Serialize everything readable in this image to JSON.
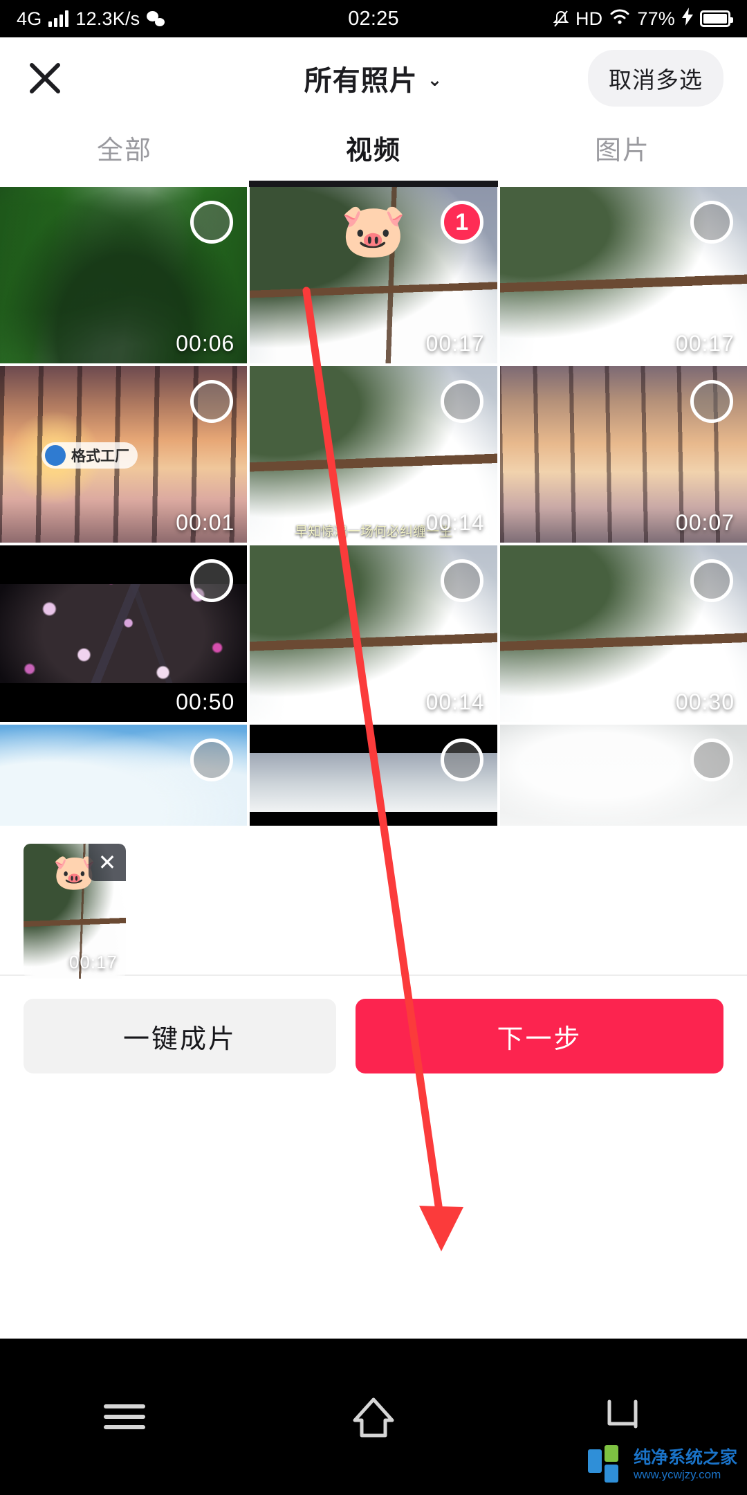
{
  "status_bar": {
    "network_type": "4G",
    "data_rate": "12.3K/s",
    "time": "02:25",
    "hd_label": "HD",
    "battery_percent": "77%",
    "icons": [
      "signal-bars-icon",
      "wechat-icon",
      "mute-icon",
      "wifi-icon",
      "charging-bolt-icon",
      "battery-icon"
    ]
  },
  "header": {
    "close_label": "✕",
    "title": "所有照片",
    "caret": "⌄",
    "multi_select_button": "取消多选"
  },
  "tabs": [
    {
      "label": "全部",
      "active": false
    },
    {
      "label": "视频",
      "active": true
    },
    {
      "label": "图片",
      "active": false
    }
  ],
  "grid": {
    "items": [
      {
        "duration": "00:06",
        "selected": false,
        "badge": "",
        "scene": "scene-waterfall",
        "overlay": ""
      },
      {
        "duration": "00:17",
        "selected": true,
        "badge": "1",
        "scene": "scene-snowbridge",
        "overlay": "pig"
      },
      {
        "duration": "00:17",
        "selected": false,
        "badge": "",
        "scene": "scene-snowbridge2",
        "overlay": ""
      },
      {
        "duration": "00:01",
        "selected": false,
        "badge": "",
        "scene": "scene-sunset",
        "overlay": "watermark",
        "watermark_text": "格式工厂"
      },
      {
        "duration": "00:14",
        "selected": false,
        "badge": "",
        "scene": "scene-snowbridge2",
        "overlay": "caption",
        "caption": "早知惊鸿一场何必纠缠一生"
      },
      {
        "duration": "00:07",
        "selected": false,
        "badge": "",
        "scene": "scene-sunset2",
        "overlay": ""
      },
      {
        "duration": "00:50",
        "selected": false,
        "badge": "",
        "scene": "scene-blossom",
        "overlay": ""
      },
      {
        "duration": "00:14",
        "selected": false,
        "badge": "",
        "scene": "scene-snowbridge2",
        "overlay": ""
      },
      {
        "duration": "00:30",
        "selected": false,
        "badge": "",
        "scene": "scene-snowbridge2",
        "overlay": ""
      },
      {
        "duration": "",
        "selected": false,
        "badge": "",
        "scene": "scene-birds",
        "overlay": ""
      },
      {
        "duration": "",
        "selected": false,
        "badge": "",
        "scene": "scene-darkstrip",
        "overlay": ""
      },
      {
        "duration": "",
        "selected": false,
        "badge": "",
        "scene": "scene-fog",
        "overlay": ""
      }
    ]
  },
  "tray": {
    "items": [
      {
        "duration": "00:17",
        "remove_label": "✕",
        "scene": "scene-snowbridge",
        "overlay": "pig"
      }
    ]
  },
  "action_bar": {
    "secondary_label": "一键成片",
    "primary_label": "下一步"
  },
  "nav_bar": {
    "buttons": [
      "menu-icon",
      "home-icon",
      "back-icon"
    ]
  },
  "annotation": {
    "arrow_color": "#fb3b3b"
  },
  "site_watermark": {
    "name": "纯净系统之家",
    "url": "www.ycwjzy.com"
  },
  "colors": {
    "accent_red": "#fc244f",
    "badge_red": "#fe2c55",
    "tab_active": "#17171b",
    "tab_inactive": "#9a9a9f"
  }
}
